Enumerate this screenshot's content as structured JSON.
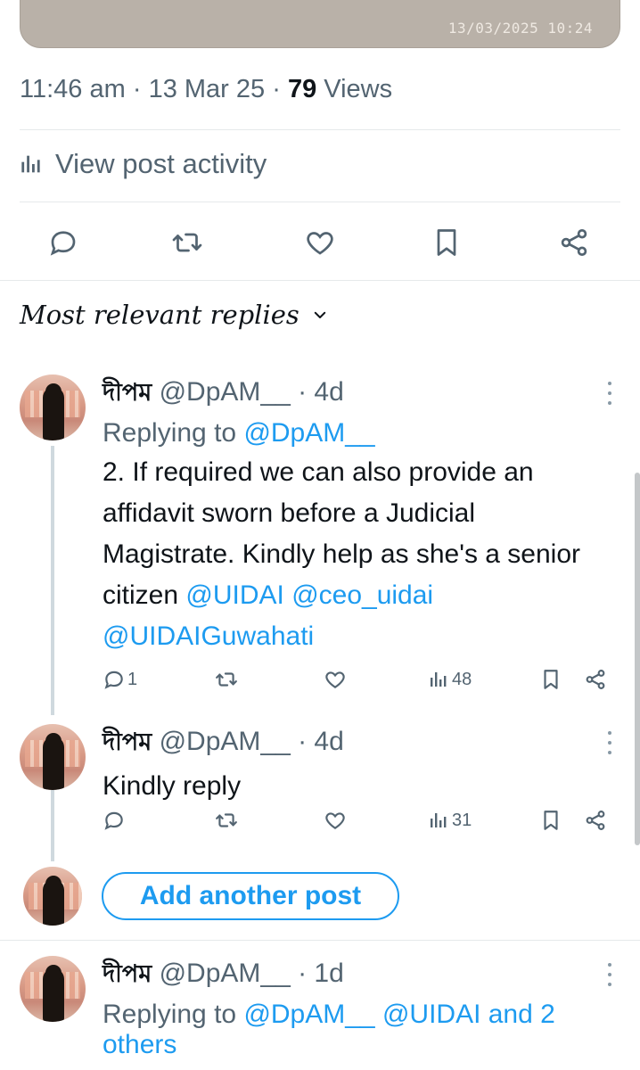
{
  "media": {
    "timestamp": "13/03/2025 10:24"
  },
  "meta": {
    "time": "11:46 am",
    "date": "13 Mar 25",
    "views_count": "79",
    "views_label": "Views",
    "sep": "·"
  },
  "activity": {
    "label": "View post activity",
    "icon": "analytics-icon"
  },
  "actions": [
    "reply-icon",
    "repost-icon",
    "like-icon",
    "bookmark-icon",
    "share-icon"
  ],
  "sort": {
    "label": "Most relevant replies"
  },
  "posts": [
    {
      "name": "দীপম",
      "handle": "@DpAM__",
      "age": "· 4d",
      "replying_prefix": "Replying to",
      "replying_to": "@DpAM__",
      "text_plain": "2. If required we can also provide an affidavit sworn before a Judicial Magistrate. Kindly help as she's a senior citizen",
      "mentions": "@UIDAI @ceo_uidai",
      "mentions2": "@UIDAIGuwahati",
      "replies": "1",
      "views": "48"
    },
    {
      "name": "দীপম",
      "handle": "@DpAM__",
      "age": "· 4d",
      "text": "Kindly reply",
      "views": "31"
    },
    {
      "name": "দীপম",
      "handle": "@DpAM__",
      "age": "· 1d",
      "replying_prefix": "Replying to",
      "replying_to": "@DpAM__ @UIDAI and 2",
      "replying_to_2": "others"
    }
  ],
  "add_post": {
    "label": "Add another post"
  },
  "colors": {
    "accent": "#1d9bf0",
    "muted": "#536471",
    "text": "#0f1419"
  }
}
